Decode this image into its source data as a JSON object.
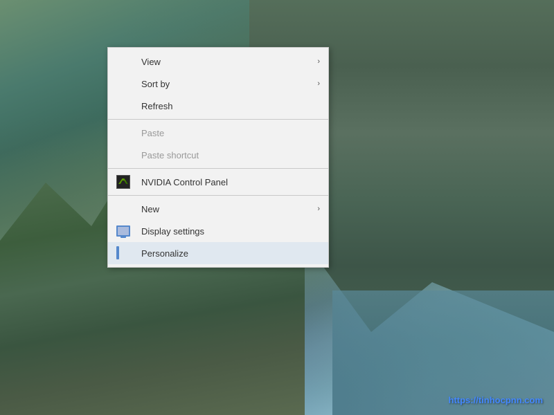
{
  "desktop": {
    "watermark": "https://tinhocpnn.com"
  },
  "context_menu": {
    "items": [
      {
        "id": "view",
        "label": "View",
        "has_arrow": true,
        "disabled": false,
        "has_icon": false,
        "separator_after": false
      },
      {
        "id": "sort-by",
        "label": "Sort by",
        "has_arrow": true,
        "disabled": false,
        "has_icon": false,
        "separator_after": false
      },
      {
        "id": "refresh",
        "label": "Refresh",
        "has_arrow": false,
        "disabled": false,
        "has_icon": false,
        "separator_after": true
      },
      {
        "id": "paste",
        "label": "Paste",
        "has_arrow": false,
        "disabled": true,
        "has_icon": false,
        "separator_after": false
      },
      {
        "id": "paste-shortcut",
        "label": "Paste shortcut",
        "has_arrow": false,
        "disabled": true,
        "has_icon": false,
        "separator_after": true
      },
      {
        "id": "nvidia",
        "label": "NVIDIA Control Panel",
        "has_arrow": false,
        "disabled": false,
        "has_icon": true,
        "icon_type": "nvidia",
        "separator_after": true
      },
      {
        "id": "new",
        "label": "New",
        "has_arrow": true,
        "disabled": false,
        "has_icon": false,
        "separator_after": false
      },
      {
        "id": "display-settings",
        "label": "Display settings",
        "has_arrow": false,
        "disabled": false,
        "has_icon": true,
        "icon_type": "display",
        "separator_after": false
      },
      {
        "id": "personalize",
        "label": "Personalize",
        "has_arrow": false,
        "disabled": false,
        "has_icon": true,
        "icon_type": "personalize",
        "separator_after": false,
        "highlighted": true
      }
    ]
  }
}
